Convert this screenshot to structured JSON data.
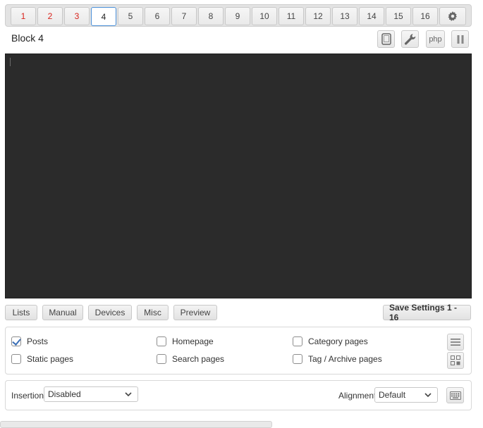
{
  "tabs": [
    {
      "label": "1",
      "state": "red"
    },
    {
      "label": "2",
      "state": "red"
    },
    {
      "label": "3",
      "state": "red"
    },
    {
      "label": "4",
      "state": "active"
    },
    {
      "label": "5",
      "state": "normal"
    },
    {
      "label": "6",
      "state": "normal"
    },
    {
      "label": "7",
      "state": "normal"
    },
    {
      "label": "8",
      "state": "normal"
    },
    {
      "label": "9",
      "state": "normal"
    },
    {
      "label": "10",
      "state": "normal"
    },
    {
      "label": "11",
      "state": "normal"
    },
    {
      "label": "12",
      "state": "normal"
    },
    {
      "label": "13",
      "state": "normal"
    },
    {
      "label": "14",
      "state": "normal"
    },
    {
      "label": "15",
      "state": "normal"
    },
    {
      "label": "16",
      "state": "normal"
    }
  ],
  "header": {
    "title": "Block 4",
    "php_label": "php",
    "icons": [
      "gear-icon",
      "tablet-icon",
      "wrench-icon",
      "pause-icon"
    ]
  },
  "toolbar": {
    "lists": "Lists",
    "manual": "Manual",
    "devices": "Devices",
    "misc": "Misc",
    "preview": "Preview",
    "save": "Save Settings 1 - 16"
  },
  "pages": {
    "posts": {
      "label": "Posts",
      "checked": true
    },
    "homepage": {
      "label": "Homepage",
      "checked": false
    },
    "category": {
      "label": "Category pages",
      "checked": false
    },
    "static": {
      "label": "Static pages",
      "checked": false
    },
    "search": {
      "label": "Search pages",
      "checked": false
    },
    "tag_archive": {
      "label": "Tag / Archive pages",
      "checked": false
    }
  },
  "insertion": {
    "label": "Insertion",
    "value": "Disabled"
  },
  "alignment": {
    "label": "Alignment",
    "value": "Default"
  },
  "colors": {
    "active_tab_border": "#4a90d9",
    "red_tab_text": "#d9231c",
    "editor_bg": "#2b2b2b"
  }
}
